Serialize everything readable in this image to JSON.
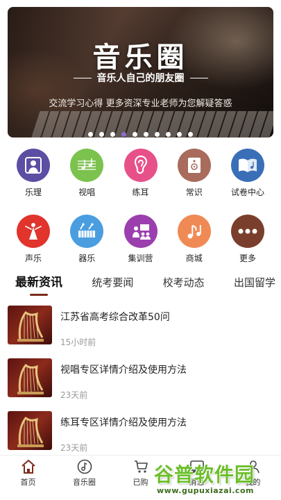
{
  "banner": {
    "title": "音乐圈",
    "subtitle": "音乐人自己的朋友圈",
    "description": "交流学习心得 更多资深专业老师为您解疑答惑",
    "dot_count": 10,
    "active_dot": 3
  },
  "categories": [
    {
      "label": "乐理",
      "icon": "music-theory-icon",
      "color": "#5b4ea3"
    },
    {
      "label": "视唱",
      "icon": "sight-singing-icon",
      "color": "#7cc24e"
    },
    {
      "label": "练耳",
      "icon": "ear-training-icon",
      "color": "#e8508a"
    },
    {
      "label": "常识",
      "icon": "knowledge-icon",
      "color": "#a86b5c"
    },
    {
      "label": "试卷中心",
      "icon": "exam-center-icon",
      "color": "#3a6fb8"
    },
    {
      "label": "声乐",
      "icon": "vocal-icon",
      "color": "#e0342c"
    },
    {
      "label": "器乐",
      "icon": "instrument-icon",
      "color": "#4a9ee0"
    },
    {
      "label": "集训营",
      "icon": "training-camp-icon",
      "color": "#9b3fae"
    },
    {
      "label": "商城",
      "icon": "store-icon",
      "color": "#f08a55"
    },
    {
      "label": "更多",
      "icon": "more-icon",
      "color": "#7a3f2c"
    }
  ],
  "tabs": [
    {
      "label": "最新资讯",
      "active": true
    },
    {
      "label": "统考要闻",
      "active": false
    },
    {
      "label": "校考动态",
      "active": false
    },
    {
      "label": "出国留学",
      "active": false
    }
  ],
  "news": [
    {
      "title": "江苏省高考综合改革50问",
      "time": "15小时前"
    },
    {
      "title": "视唱专区详情介绍及使用方法",
      "time": "23天前"
    },
    {
      "title": "练耳专区详情介绍及使用方法",
      "time": "23天前"
    }
  ],
  "bottom_nav": [
    {
      "label": "首页",
      "icon": "home-icon",
      "active": true
    },
    {
      "label": "音乐圈",
      "icon": "music-note-icon",
      "active": false
    },
    {
      "label": "已购",
      "icon": "cart-icon",
      "active": false
    },
    {
      "label": "消息",
      "icon": "message-icon",
      "active": false
    },
    {
      "label": "我的",
      "icon": "user-icon",
      "active": false
    }
  ],
  "watermark": {
    "main": "谷普软件园",
    "url": "www.gupuxiazai.com"
  }
}
